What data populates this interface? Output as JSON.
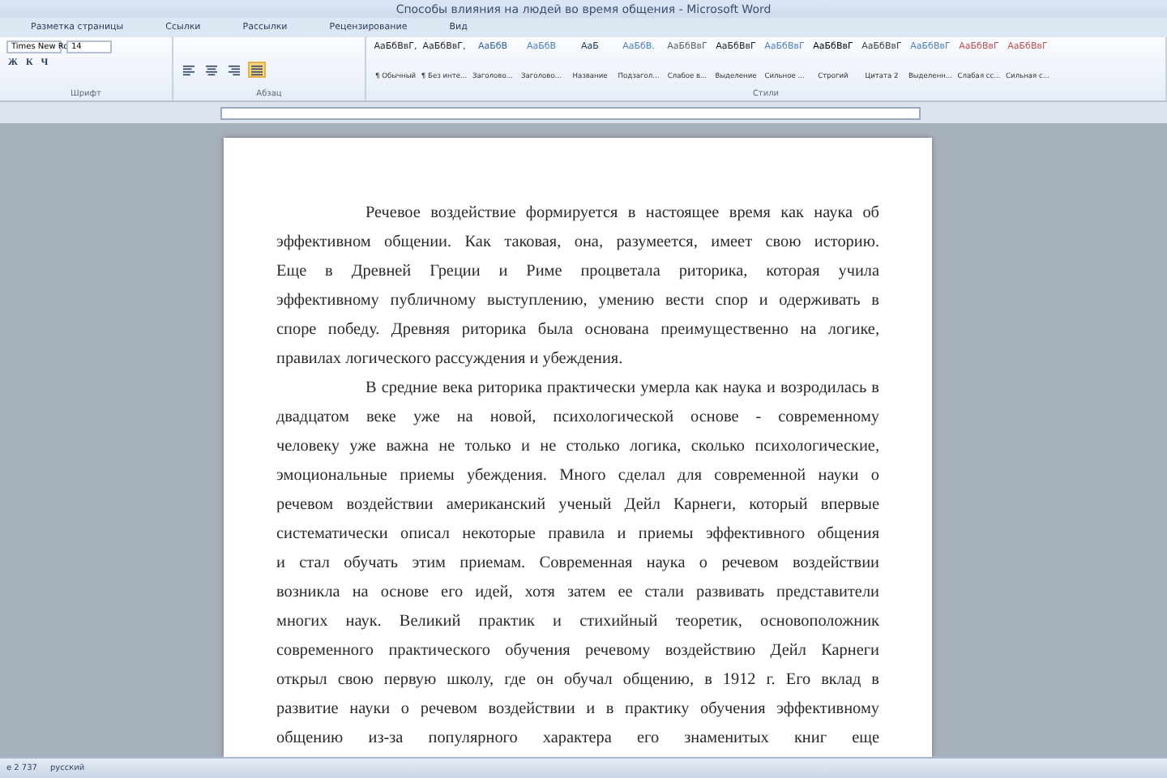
{
  "window": {
    "title": "Способы влияния на людей во время общения - Microsoft Word"
  },
  "tabs": [
    {
      "label": "Разметка страницы",
      "selected": false
    },
    {
      "label": "Ссылки",
      "selected": false
    },
    {
      "label": "Рассылки",
      "selected": false
    },
    {
      "label": "Рецензирование",
      "selected": false
    },
    {
      "label": "Вид",
      "selected": false
    }
  ],
  "font_group": {
    "label": "Шрифт",
    "font": "Times New Ro",
    "size": "14",
    "format_keys": [
      "Ж",
      "К",
      "Ч"
    ]
  },
  "paragraph_group": {
    "label": "Абзац",
    "alignments": [
      {
        "kind": "left",
        "selected": false
      },
      {
        "kind": "center",
        "selected": false
      },
      {
        "kind": "right",
        "selected": false
      },
      {
        "kind": "justify",
        "selected": true
      }
    ]
  },
  "styles_group": {
    "label": "Стили",
    "styles": [
      {
        "preview": "АаБбВвГ,",
        "name": "¶ Обычный",
        "color": "#1f1f1f"
      },
      {
        "preview": "АаБбВвГ,",
        "name": "¶ Без инте...",
        "color": "#1f1f1f"
      },
      {
        "preview": "АаБбВ",
        "name": "Заголово...",
        "color": "#2f5f9f"
      },
      {
        "preview": "АаБбВ",
        "name": "Заголово...",
        "color": "#4f81bd"
      },
      {
        "preview": "АаБ",
        "name": "Название",
        "color": "#17365d"
      },
      {
        "preview": "АаБбВ.",
        "name": "Подзагол...",
        "color": "#4f81bd"
      },
      {
        "preview": "АаБбВвГ",
        "name": "Слабое в...",
        "color": "#606060"
      },
      {
        "preview": "АаБбВвГ",
        "name": "Выделение",
        "color": "#1f1f1f"
      },
      {
        "preview": "АаБбВвГ",
        "name": "Сильное ...",
        "color": "#4f81bd"
      },
      {
        "preview": "АаБбВвГ",
        "name": "Строгий",
        "color": "#000000"
      },
      {
        "preview": "АаБбВвГ",
        "name": "Цитата 2",
        "color": "#404040"
      },
      {
        "preview": "АаБбВвГ",
        "name": "Выделенн...",
        "color": "#4f81bd"
      },
      {
        "preview": "АаБбВвГ",
        "name": "Слабая сс...",
        "color": "#c0504d"
      },
      {
        "preview": "АаБбВвГ",
        "name": "Сильная с...",
        "color": "#c0504d"
      }
    ]
  },
  "document": {
    "paragraphs": [
      {
        "lines": [
          "Речевое воздействие формируется в настоящее время как наука об",
          "эффективном общении. Как таковая, она, разумеется, имеет свою историю.",
          "Еще в Древней Греции и Риме процветала риторика, которая учила",
          "эффективному публичному выступлению, умению вести спор и одерживать в",
          "споре победу. Древняя риторика была основана преимущественно на логике,",
          "правилах логического рассуждения и убеждения."
        ]
      },
      {
        "lines": [
          "В средние века риторика практически умерла как наука и возродилась в",
          "двадцатом веке уже на новой, психологической основе - современному",
          "человеку уже важна не только и не столько логика, сколько психологические,",
          "эмоциональные приемы убеждения. Много сделал для современной науки о",
          "речевом воздействии американский ученый Дейл Карнеги, который впервые",
          "систематически описал некоторые правила и приемы эффективного общения",
          "и стал обучать этим приемам. Современная наука о речевом воздействии",
          "возникла на основе его идей, хотя затем ее стали развивать представители",
          "многих наук. Великий практик и стихийный теоретик, основоположник",
          "современного практического обучения речевому воздействию Дейл Карнеги",
          "открыл свою первую школу, где он обучал общению, в 1912 г. Его вклад в",
          "развитие науки о речевом воздействии и в практику обучения эффективному",
          "общению из-за популярного характера его знаменитых книг еще"
        ]
      }
    ]
  },
  "status_bar": {
    "word_count": "е 2 737",
    "language": "русский"
  }
}
